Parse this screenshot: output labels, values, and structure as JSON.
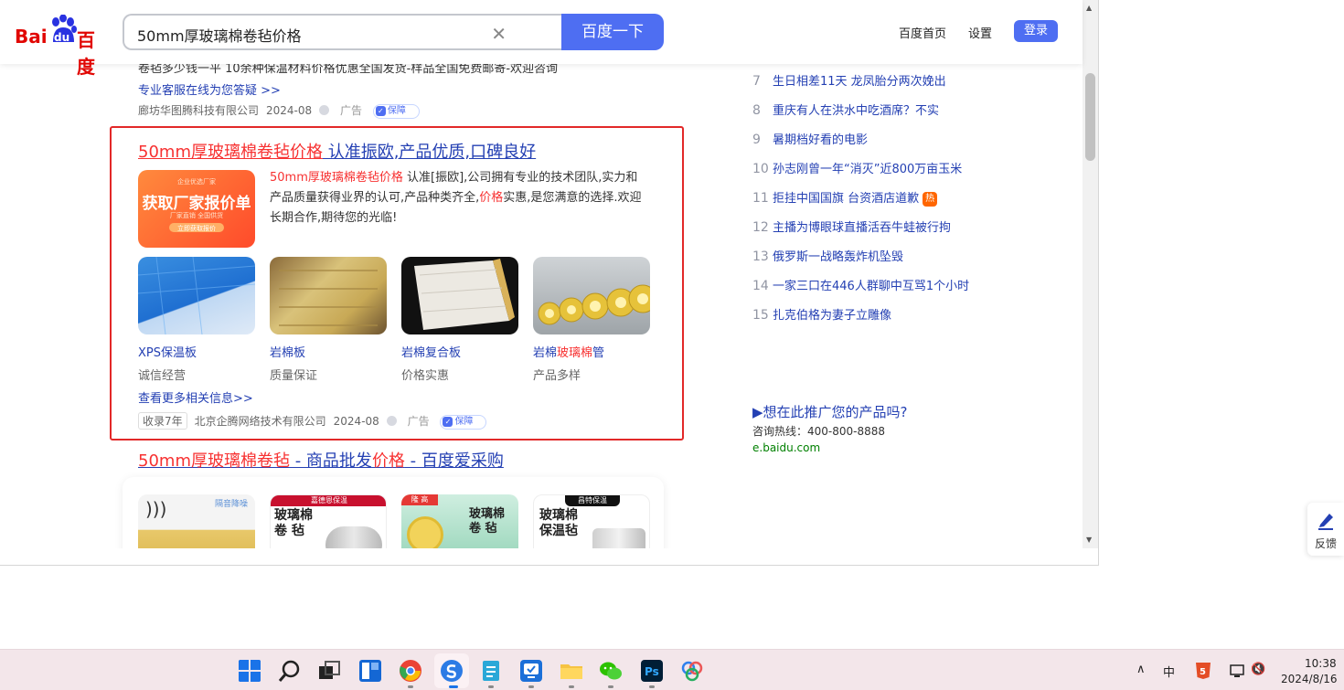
{
  "header": {
    "logo_left": "Bai",
    "logo_du": "du",
    "logo_right": "百度",
    "search_value": "50mm厚玻璃棉卷毡价格",
    "search_button": "百度一下",
    "links": [
      "百度首页",
      "设置"
    ],
    "login": "登录"
  },
  "ad1": {
    "line1": "卷毡多少钱一平 10余种保温材料价格优惠全国发货-样品全国免费邮寄-欢迎咨询",
    "line2": "专业客服在线为您答疑 >>",
    "company": "廊坊华图腾科技有限公司",
    "date": "2024-08",
    "ad_label": "广告",
    "guarantee": "保障"
  },
  "ad2": {
    "title_red": "50mm厚玻璃棉卷毡价格",
    "title_rest": " 认准振欧,产品优质,口碑良好",
    "banner_top": "企业优选厂家",
    "banner_main": "获取厂家报价单",
    "banner_sub": "厂家直销 全国供货",
    "banner_pill": "立即获取报价",
    "desc_red1": "50mm厚玻璃棉卷毡价格",
    "desc_part1": " 认准[振欧],公司拥有专业的技术团队,实力和产品质量获得业界的认可,产品种类齐全,",
    "desc_red2": "价格",
    "desc_part2": "实惠,是您满意的选择.欢迎长期合作,期待您的光临!",
    "products": [
      {
        "name": "XPS保温板",
        "name_red": "",
        "name_after": "",
        "sub": "诚信经营"
      },
      {
        "name": "岩棉板",
        "name_red": "",
        "name_after": "",
        "sub": "质量保证"
      },
      {
        "name": "岩棉复合板",
        "name_red": "",
        "name_after": "",
        "sub": "价格实惠"
      },
      {
        "name": "岩棉",
        "name_red": "玻璃棉",
        "name_after": "管",
        "sub": "产品多样"
      }
    ],
    "more": "查看更多相关信息>>",
    "shoulu": "收录7年",
    "company": "北京企腾网络技术有限公司",
    "date": "2024-08",
    "ad_label": "广告",
    "guarantee": "保障"
  },
  "result3": {
    "title_red": "50mm厚玻璃棉卷毡",
    "title_mid": " - 商品批发",
    "title_red2": "价格",
    "title_end": " - 百度爱采购",
    "images": [
      {
        "label": "隔音降噪"
      },
      {
        "tag": "嘉德恩保温",
        "label": "玻璃棉\n卷 毡"
      },
      {
        "tag": "隆 高",
        "label": "玻璃棉\n卷 毡"
      },
      {
        "tag": "昌特保温",
        "label": "玻璃棉\n保温毡"
      }
    ]
  },
  "hotlist": [
    {
      "num": "7",
      "text": "生日相差11天 龙凤胎分两次娩出",
      "badge": ""
    },
    {
      "num": "8",
      "text": "重庆有人在洪水中吃酒席？不实",
      "badge": ""
    },
    {
      "num": "9",
      "text": "暑期档好看的电影",
      "badge": ""
    },
    {
      "num": "10",
      "text": "孙志刚曾一年“消灭”近800万亩玉米",
      "badge": ""
    },
    {
      "num": "11",
      "text": "拒挂中国国旗 台资酒店道歉",
      "badge": "热"
    },
    {
      "num": "12",
      "text": "主播为博眼球直播活吞牛蛙被行拘",
      "badge": ""
    },
    {
      "num": "13",
      "text": "俄罗斯一战略轰炸机坠毁",
      "badge": ""
    },
    {
      "num": "14",
      "text": "一家三口在446人群聊中互骂1个小时",
      "badge": ""
    },
    {
      "num": "15",
      "text": "扎克伯格为妻子立雕像",
      "badge": ""
    }
  ],
  "promo": {
    "title": "▶想在此推广您的产品吗?",
    "phone": "咨询热线：400-800-8888",
    "site": "e.baidu.com"
  },
  "feedback": "反馈",
  "tray": {
    "ime": "中",
    "time": "10:38",
    "date": "2024/8/16"
  },
  "colors": {
    "brand_blue": "#4e6ef2",
    "link_blue": "#2440b3",
    "highlight_red": "#f73131",
    "box_red": "#e22828"
  }
}
